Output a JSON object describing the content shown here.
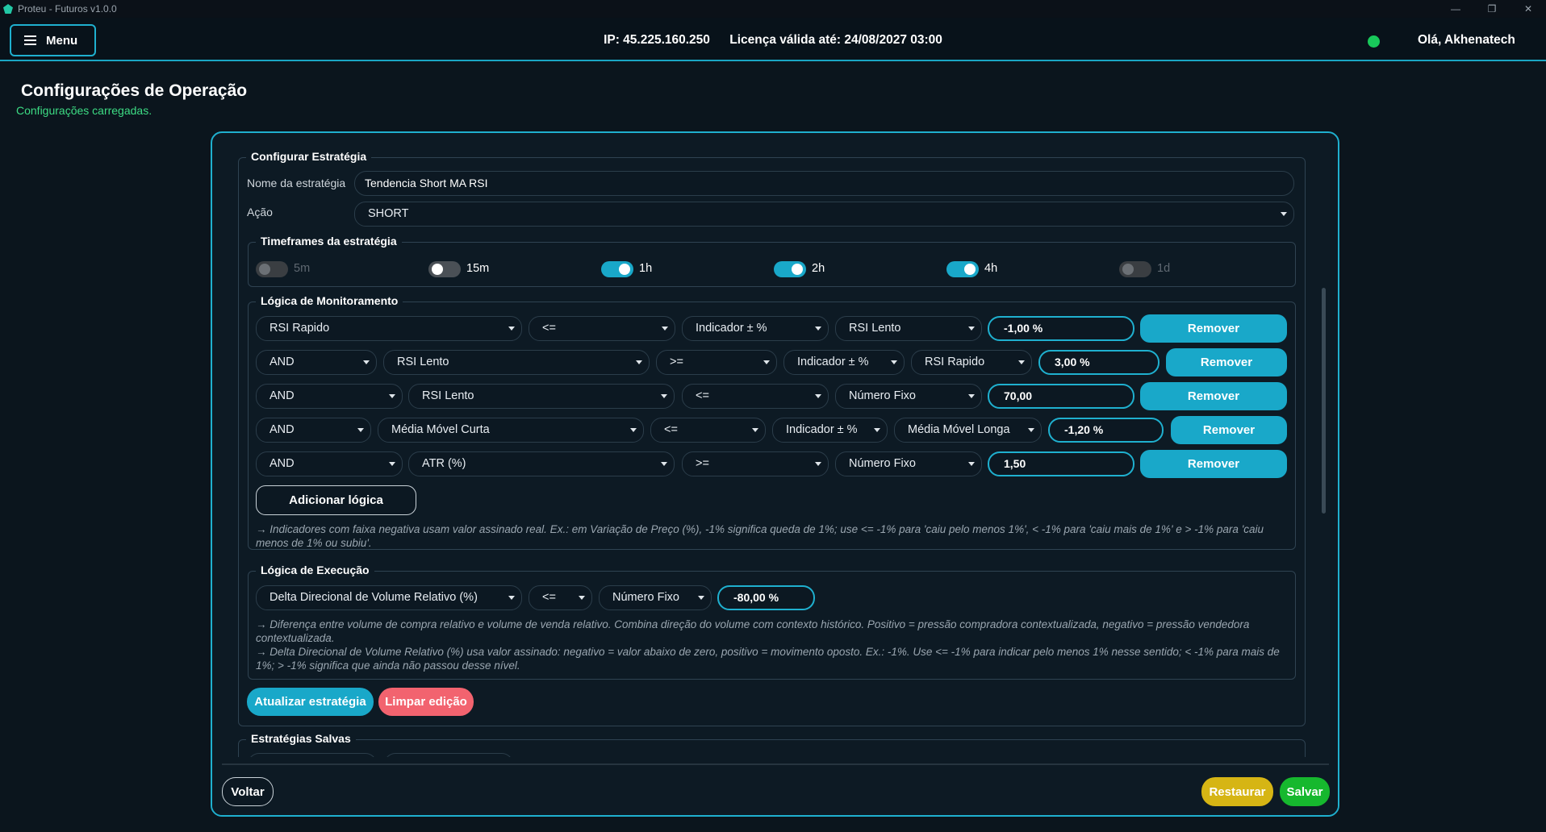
{
  "window": {
    "title": "Proteu - Futuros v1.0.0"
  },
  "topbar": {
    "menu_label": "Menu",
    "ip": "IP: 45.225.160.250",
    "license": "Licença válida até: 24/08/2027 03:00",
    "greeting": "Olá, Akhenatech",
    "status_color": "#18c95a"
  },
  "page": {
    "title": "Configurações de Operação",
    "subtitle": "Configurações carregadas."
  },
  "strategy": {
    "legend": "Configurar Estratégia",
    "name_label": "Nome da estratégia",
    "name_value": "Tendencia Short MA RSI",
    "action_label": "Ação",
    "action_value": "SHORT"
  },
  "timeframes": {
    "legend": "Timeframes da estratégia",
    "items": [
      {
        "label": "5m",
        "state": "disabled"
      },
      {
        "label": "15m",
        "state": "off"
      },
      {
        "label": "1h",
        "state": "on"
      },
      {
        "label": "2h",
        "state": "on"
      },
      {
        "label": "4h",
        "state": "on"
      },
      {
        "label": "1d",
        "state": "disabled"
      }
    ]
  },
  "monitoring": {
    "legend": "Lógica de Monitoramento",
    "rows": [
      {
        "connector": "",
        "indicator": "RSI Rapido",
        "operator": "<=",
        "compare_type": "Indicador ± %",
        "compare_target": "RSI Lento",
        "value": "-1,00 %",
        "remove": "Remover"
      },
      {
        "connector": "AND",
        "indicator": "RSI Lento",
        "operator": ">=",
        "compare_type": "Indicador ± %",
        "compare_target": "RSI Rapido",
        "value": "3,00 %",
        "remove": "Remover"
      },
      {
        "connector": "AND",
        "indicator": "RSI Lento",
        "operator": "<=",
        "compare_type": "Número Fixo",
        "compare_target": "",
        "value": "70,00",
        "remove": "Remover"
      },
      {
        "connector": "AND",
        "indicator": "Média Móvel Curta",
        "operator": "<=",
        "compare_type": "Indicador ± %",
        "compare_target": "Média Móvel Longa",
        "value": "-1,20 %",
        "remove": "Remover"
      },
      {
        "connector": "AND",
        "indicator": "ATR (%)",
        "operator": ">=",
        "compare_type": "Número Fixo",
        "compare_target": "",
        "value": "1,50",
        "remove": "Remover"
      }
    ],
    "add_label": "Adicionar lógica",
    "note": "→ Indicadores com faixa negativa usam valor assinado real. Ex.: em Variação de Preço (%), -1% significa queda de 1%; use <= -1% para 'caiu pelo menos 1%', < -1% para 'caiu mais de 1%' e > -1% para 'caiu menos de 1% ou subiu'."
  },
  "execution": {
    "legend": "Lógica de Execução",
    "indicator": "Delta Direcional de Volume Relativo (%)",
    "operator": "<=",
    "compare_type": "Número Fixo",
    "value": "-80,00 %",
    "note1": "→ Diferença entre volume de compra relativo e volume de venda relativo. Combina direção do volume com contexto histórico. Positivo = pressão compradora contextualizada, negativo = pressão vendedora contextualizada.",
    "note2": "→ Delta Direcional de Volume Relativo (%) usa valor assinado: negativo = valor abaixo de zero, positivo = movimento oposto. Ex.: -1%. Use <= -1% para indicar pelo menos 1% nesse sentido; < -1% para mais de 1%; > -1% significa que ainda não passou desse nível."
  },
  "actions": {
    "update": "Atualizar estratégia",
    "clear": "Limpar edição"
  },
  "saved": {
    "legend": "Estratégias Salvas"
  },
  "footer": {
    "back": "Voltar",
    "restore": "Restaurar",
    "save": "Salvar"
  },
  "colors": {
    "accent": "#19a8c9",
    "danger": "#f2636f",
    "warning": "#d6b514",
    "success": "#16b82e"
  }
}
